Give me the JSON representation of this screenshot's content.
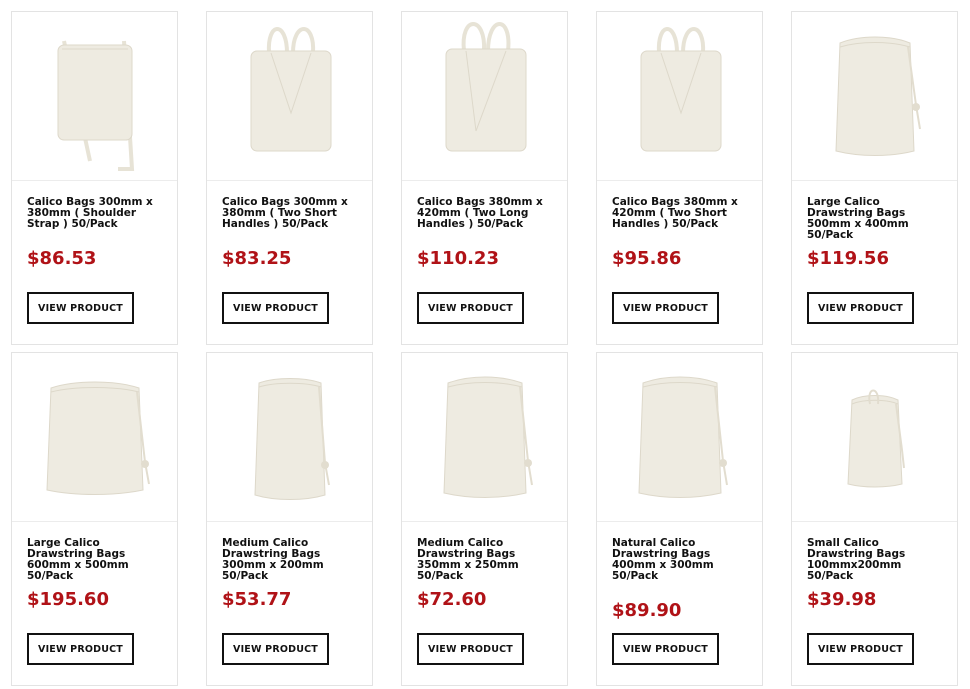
{
  "colors": {
    "price": "#b01217",
    "bag": "#eeebe1",
    "bag_shadow": "#ddd8ca",
    "border": "#e3e3e3"
  },
  "products": [
    {
      "title": "Calico Bags 300mm x 380mm ( Shoulder Strap ) 50/Pack",
      "price": "$86.53",
      "button": "VIEW PRODUCT",
      "icon": "tote-bag-shoulder-strap-icon"
    },
    {
      "title": "Calico Bags 300mm x 380mm ( Two Short Handles ) 50/Pack",
      "price": "$83.25",
      "button": "VIEW PRODUCT",
      "icon": "tote-bag-short-handles-icon"
    },
    {
      "title": "Calico Bags 380mm x 420mm ( Two Long Handles ) 50/Pack",
      "price": "$110.23",
      "button": "VIEW PRODUCT",
      "icon": "tote-bag-long-handles-icon"
    },
    {
      "title": "Calico Bags 380mm x 420mm ( Two Short Handles ) 50/Pack",
      "price": "$95.86",
      "button": "VIEW PRODUCT",
      "icon": "tote-bag-short-handles-icon"
    },
    {
      "title": "Large Calico Drawstring Bags 500mm x 400mm 50/Pack",
      "price": "$119.56",
      "button": "VIEW PRODUCT",
      "icon": "drawstring-bag-icon"
    },
    {
      "title": "Large Calico Drawstring Bags 600mm x 500mm 50/Pack",
      "price": "$195.60",
      "button": "VIEW PRODUCT",
      "icon": "drawstring-bag-icon"
    },
    {
      "title": "Medium Calico Drawstring Bags 300mm x 200mm 50/Pack",
      "price": "$53.77",
      "button": "VIEW PRODUCT",
      "icon": "drawstring-bag-icon"
    },
    {
      "title": "Medium Calico Drawstring Bags 350mm x 250mm 50/Pack",
      "price": "$72.60",
      "button": "VIEW PRODUCT",
      "icon": "drawstring-bag-icon"
    },
    {
      "title": "Natural Calico Drawstring Bags 400mm x 300mm 50/Pack",
      "price": "$89.90",
      "button": "VIEW PRODUCT",
      "icon": "drawstring-bag-icon"
    },
    {
      "title": "Small Calico Drawstring Bags 100mmx200mm 50/Pack",
      "price": "$39.98",
      "button": "VIEW PRODUCT",
      "icon": "drawstring-bag-icon"
    }
  ]
}
